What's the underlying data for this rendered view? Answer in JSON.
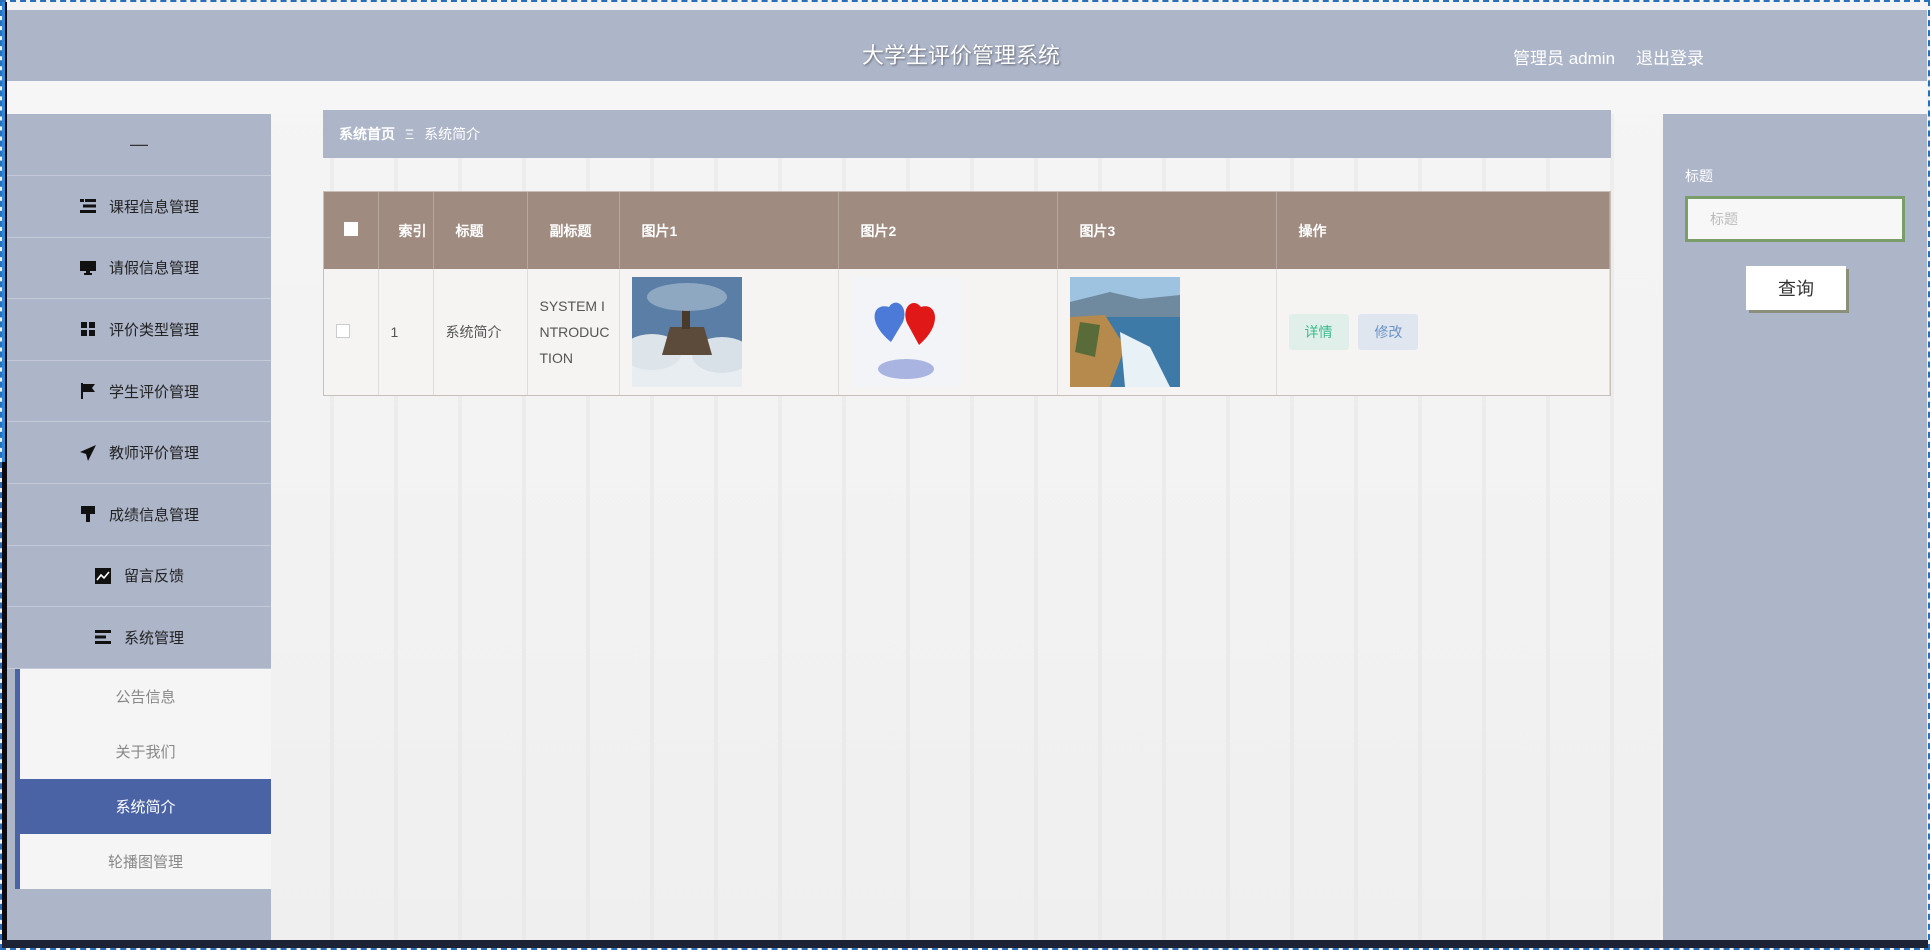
{
  "header": {
    "title": "大学生评价管理系统",
    "user": "管理员 admin",
    "logout": "退出登录"
  },
  "sidebar": {
    "toggle": "—",
    "items": [
      {
        "label": "课程信息管理",
        "icon": "list-icon"
      },
      {
        "label": "请假信息管理",
        "icon": "monitor-icon"
      },
      {
        "label": "评价类型管理",
        "icon": "grid-icon"
      },
      {
        "label": "学生评价管理",
        "icon": "flag-icon"
      },
      {
        "label": "教师评价管理",
        "icon": "send-icon"
      },
      {
        "label": "成绩信息管理",
        "icon": "brush-icon"
      },
      {
        "label": "留言反馈",
        "icon": "chart-icon"
      },
      {
        "label": "系统管理",
        "icon": "menu-icon"
      }
    ],
    "subitems": [
      {
        "label": "公告信息",
        "active": false
      },
      {
        "label": "关于我们",
        "active": false
      },
      {
        "label": "系统简介",
        "active": true
      },
      {
        "label": "轮播图管理",
        "active": false
      }
    ]
  },
  "breadcrumb": {
    "home": "系统首页",
    "sep": "Ξ",
    "current": "系统简介"
  },
  "table": {
    "headers": [
      "索引",
      "标题",
      "副标题",
      "图片1",
      "图片2",
      "图片3",
      "操作"
    ],
    "rows": [
      {
        "index": "1",
        "title": "系统简介",
        "subtitle": "SYSTEM INTRODUCTION"
      }
    ],
    "actions": {
      "detail": "详情",
      "edit": "修改"
    }
  },
  "search": {
    "label": "标题",
    "placeholder": "标题",
    "button": "查询"
  }
}
